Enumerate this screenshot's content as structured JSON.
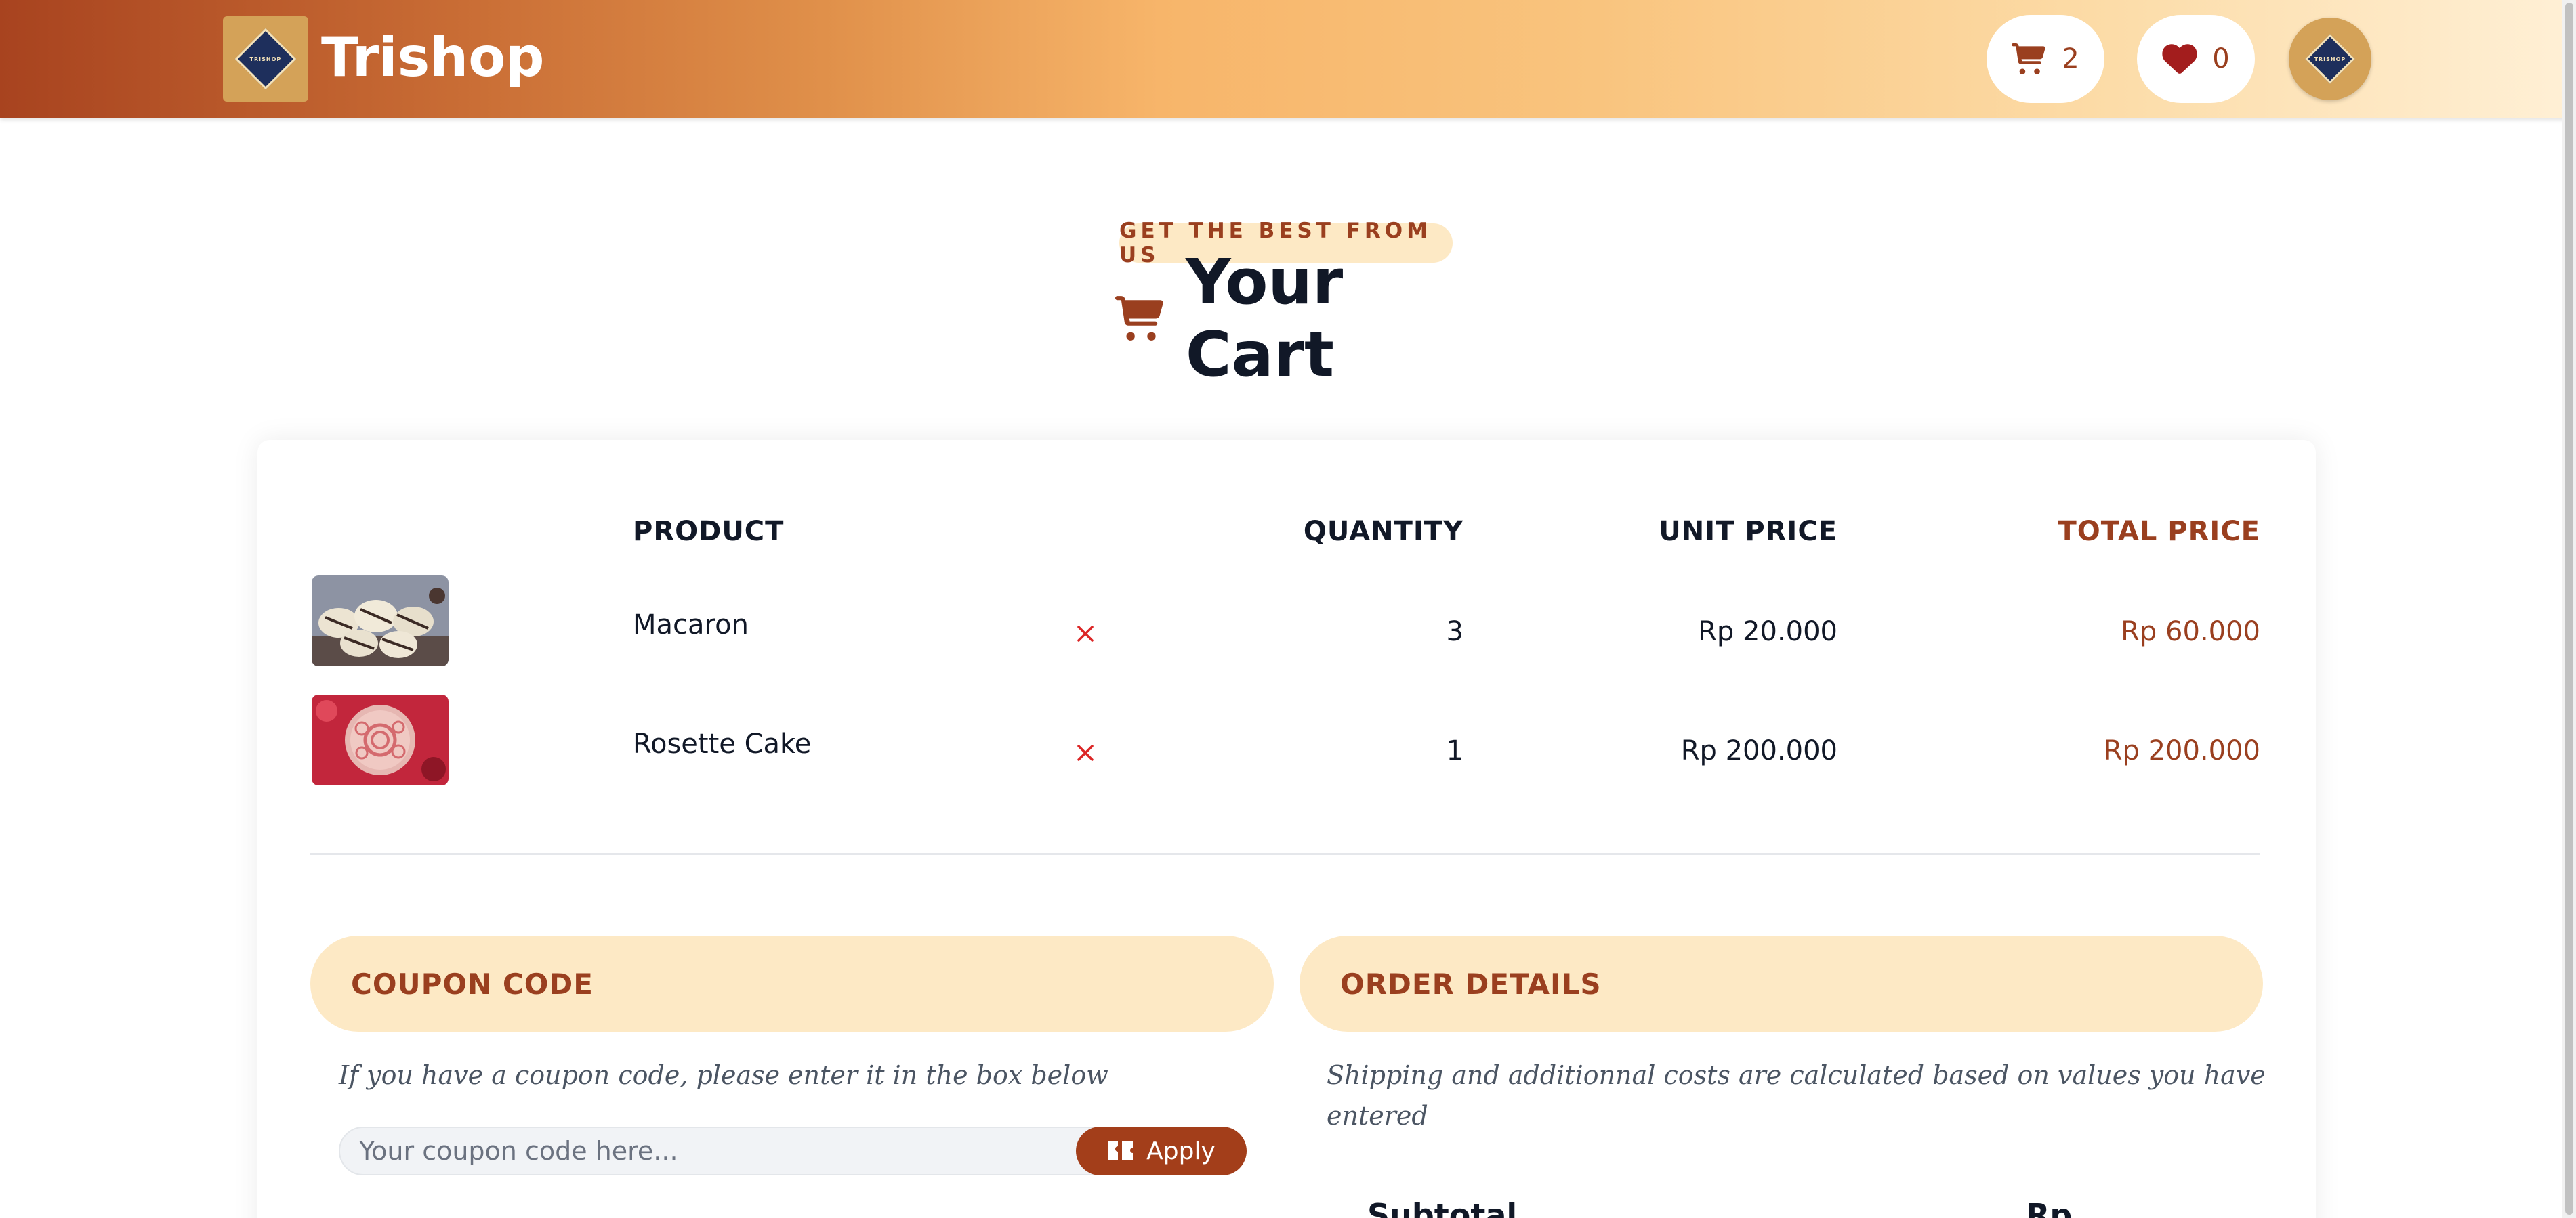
{
  "header": {
    "logo_text": "TRISHOP",
    "brand": "Trishop",
    "cart_count": "2",
    "wishlist_count": "0",
    "avatar_text": "TRISHOP",
    "gradient_colors": [
      "#a8431f",
      "#f7b56a",
      "#fff0d6"
    ]
  },
  "hero": {
    "eyebrow": "GET THE BEST FROM US",
    "title": "Your Cart"
  },
  "cart": {
    "headers": {
      "product": "PRODUCT",
      "quantity": "QUANTITY",
      "unit_price": "UNIT PRICE",
      "total_price": "TOTAL PRICE"
    },
    "items": [
      {
        "name": "Macaron",
        "quantity": "3",
        "unit_price": "Rp 20.000",
        "total_price": "Rp 60.000",
        "image": "macaron-photo"
      },
      {
        "name": "Rosette Cake",
        "quantity": "1",
        "unit_price": "Rp 200.000",
        "total_price": "Rp 200.000",
        "image": "rosette-cake-photo"
      }
    ]
  },
  "coupon": {
    "heading": "COUPON CODE",
    "hint": "If you have a coupon code, please enter it in the box below",
    "placeholder": "Your coupon code here...",
    "apply_label": "Apply"
  },
  "order": {
    "heading": "ORDER DETAILS",
    "hint": "Shipping and additionnal costs are calculated based on values you have entered",
    "subtotal_label": "Subtotal",
    "subtotal_value": "Rp"
  },
  "colors": {
    "accent": "#9a3f1f",
    "accent_bg": "#fde9c5",
    "button": "#a33e1a",
    "remove": "#dc2626",
    "logo_navy": "#1e2f5c",
    "logo_gold": "#d4a258"
  }
}
